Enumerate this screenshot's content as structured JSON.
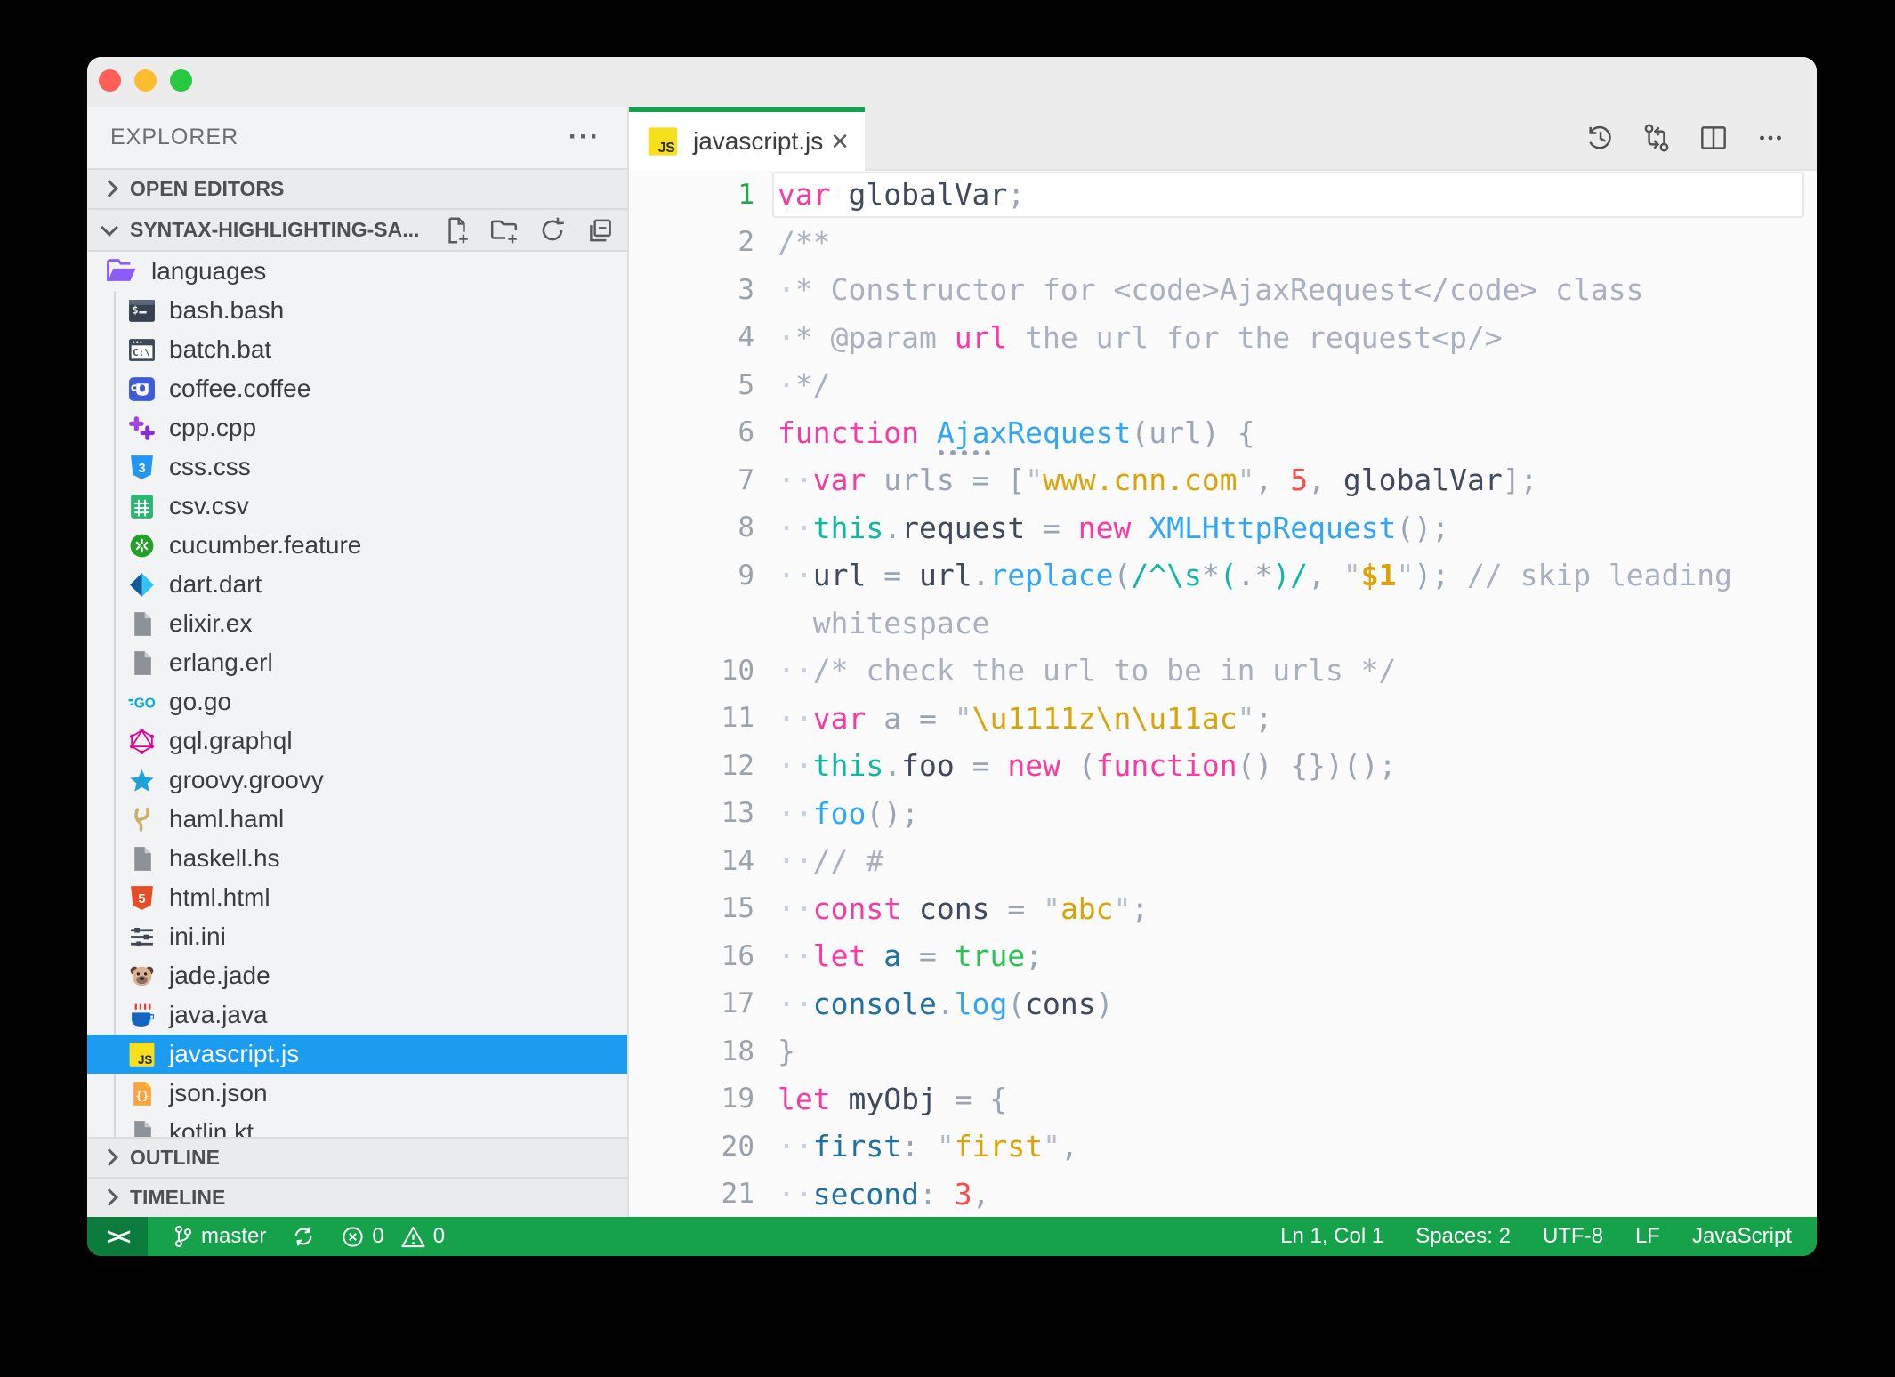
{
  "window": {
    "traffic_lights": [
      "#ff5f57",
      "#febc2e",
      "#28c840"
    ]
  },
  "explorer": {
    "title": "EXPLORER",
    "more_label": "···",
    "sections": {
      "open_editors": "OPEN EDITORS",
      "workspace": "SYNTAX-HIGHLIGHTING-SA...",
      "outline": "OUTLINE",
      "timeline": "TIMELINE"
    },
    "workspace_actions": [
      {
        "name": "new-file"
      },
      {
        "name": "new-folder"
      },
      {
        "name": "refresh-explorer"
      },
      {
        "name": "collapse-folders"
      }
    ],
    "tree": [
      {
        "label": "languages",
        "icon": "folder",
        "type": "folder"
      },
      {
        "label": "bash.bash",
        "icon": "bash"
      },
      {
        "label": "batch.bat",
        "icon": "bat"
      },
      {
        "label": "coffee.coffee",
        "icon": "coffee"
      },
      {
        "label": "cpp.cpp",
        "icon": "cpp"
      },
      {
        "label": "css.css",
        "icon": "css"
      },
      {
        "label": "csv.csv",
        "icon": "csv"
      },
      {
        "label": "cucumber.feature",
        "icon": "cucumber"
      },
      {
        "label": "dart.dart",
        "icon": "dart"
      },
      {
        "label": "elixir.ex",
        "icon": "file"
      },
      {
        "label": "erlang.erl",
        "icon": "file"
      },
      {
        "label": "go.go",
        "icon": "go"
      },
      {
        "label": "gql.graphql",
        "icon": "graphql"
      },
      {
        "label": "groovy.groovy",
        "icon": "groovy"
      },
      {
        "label": "haml.haml",
        "icon": "haml"
      },
      {
        "label": "haskell.hs",
        "icon": "file"
      },
      {
        "label": "html.html",
        "icon": "html"
      },
      {
        "label": "ini.ini",
        "icon": "ini"
      },
      {
        "label": "jade.jade",
        "icon": "jade"
      },
      {
        "label": "java.java",
        "icon": "java"
      },
      {
        "label": "javascript.js",
        "icon": "js",
        "selected": true
      },
      {
        "label": "json.json",
        "icon": "json"
      },
      {
        "label": "kotlin.kt",
        "icon": "file"
      }
    ]
  },
  "tab": {
    "label": "javascript.js",
    "icon": "js",
    "close_glyph": "×"
  },
  "editor_actions": [
    {
      "name": "timeline-history"
    },
    {
      "name": "open-changes"
    },
    {
      "name": "split-editor"
    },
    {
      "name": "more-actions"
    }
  ],
  "code": {
    "lines": [
      {
        "n": "1",
        "current": true,
        "t": [
          [
            "var",
            "kw"
          ],
          [
            " ",
            "op"
          ],
          [
            "globalVar",
            "id"
          ],
          [
            ";",
            "op"
          ]
        ]
      },
      {
        "n": "2",
        "t": [
          [
            "/**",
            "cmt"
          ]
        ]
      },
      {
        "n": "3",
        "t": [
          [
            "·",
            "ws"
          ],
          [
            "* Constructor for <code>AjaxRequest</code> class",
            "cmt"
          ]
        ]
      },
      {
        "n": "4",
        "t": [
          [
            "·",
            "ws"
          ],
          [
            "* @param ",
            "cmt"
          ],
          [
            "url",
            "kw"
          ],
          [
            " the url for the request<p/>",
            "cmt"
          ]
        ]
      },
      {
        "n": "5",
        "t": [
          [
            "·",
            "ws"
          ],
          [
            "*/",
            "cmt"
          ]
        ]
      },
      {
        "n": "6",
        "t": [
          [
            "function",
            "kw"
          ],
          [
            " ",
            "op"
          ],
          [
            "AjaxRequest",
            "fn hint"
          ],
          [
            "(",
            "op"
          ],
          [
            "url",
            "fade"
          ],
          [
            ") {",
            "op"
          ]
        ]
      },
      {
        "n": "7",
        "t": [
          [
            "··",
            "ws"
          ],
          [
            "var",
            "kw"
          ],
          [
            " ",
            "op"
          ],
          [
            "urls",
            "fade"
          ],
          [
            " = [",
            "op"
          ],
          [
            "\"",
            "sq"
          ],
          [
            "www.cnn.com",
            "str"
          ],
          [
            "\"",
            "sq"
          ],
          [
            ", ",
            "op"
          ],
          [
            "5",
            "num"
          ],
          [
            ", ",
            "op"
          ],
          [
            "globalVar",
            "id"
          ],
          [
            "];",
            "op"
          ]
        ]
      },
      {
        "n": "8",
        "t": [
          [
            "··",
            "ws"
          ],
          [
            "this",
            "ths"
          ],
          [
            ".",
            "op"
          ],
          [
            "request",
            "id"
          ],
          [
            " = ",
            "op"
          ],
          [
            "new",
            "kw"
          ],
          [
            " ",
            "op"
          ],
          [
            "XMLHttpRequest",
            "fn"
          ],
          [
            "();",
            "op"
          ]
        ]
      },
      {
        "n": "9",
        "t": [
          [
            "··",
            "ws"
          ],
          [
            "url",
            "id"
          ],
          [
            " = ",
            "op"
          ],
          [
            "url",
            "id"
          ],
          [
            ".",
            "op"
          ],
          [
            "replace",
            "fn"
          ],
          [
            "(",
            "op"
          ],
          [
            "/^\\s",
            "rx"
          ],
          [
            "*",
            "op"
          ],
          [
            "(",
            "rx"
          ],
          [
            ".*",
            "op"
          ],
          [
            ")",
            "rx"
          ],
          [
            "/",
            "rx"
          ],
          [
            ", ",
            "op"
          ],
          [
            "\"",
            "sq"
          ],
          [
            "$1",
            "strb"
          ],
          [
            "\"",
            "sq"
          ],
          [
            "); ",
            "op"
          ],
          [
            "// skip leading",
            "cmt"
          ]
        ]
      },
      {
        "n": "",
        "t": [
          [
            "  ",
            "op"
          ],
          [
            "whitespace",
            "cmt"
          ]
        ]
      },
      {
        "n": "10",
        "t": [
          [
            "··",
            "ws"
          ],
          [
            "/* check the url to be in urls */",
            "cmt"
          ]
        ]
      },
      {
        "n": "11",
        "t": [
          [
            "··",
            "ws"
          ],
          [
            "var",
            "kw"
          ],
          [
            " ",
            "op"
          ],
          [
            "a",
            "fade"
          ],
          [
            " = ",
            "op"
          ],
          [
            "\"",
            "sq"
          ],
          [
            "\\u1111z\\n\\u11ac",
            "str"
          ],
          [
            "\"",
            "sq"
          ],
          [
            ";",
            "op"
          ]
        ]
      },
      {
        "n": "12",
        "t": [
          [
            "··",
            "ws"
          ],
          [
            "this",
            "ths"
          ],
          [
            ".",
            "op"
          ],
          [
            "foo",
            "id"
          ],
          [
            " = ",
            "op"
          ],
          [
            "new",
            "kw"
          ],
          [
            " (",
            "op"
          ],
          [
            "function",
            "kw"
          ],
          [
            "() {})();",
            "op"
          ]
        ]
      },
      {
        "n": "13",
        "t": [
          [
            "··",
            "ws"
          ],
          [
            "foo",
            "fn"
          ],
          [
            "();",
            "op"
          ]
        ]
      },
      {
        "n": "14",
        "t": [
          [
            "··",
            "ws"
          ],
          [
            "// #",
            "cmt"
          ]
        ]
      },
      {
        "n": "15",
        "t": [
          [
            "··",
            "ws"
          ],
          [
            "const",
            "kw"
          ],
          [
            " ",
            "op"
          ],
          [
            "cons",
            "id"
          ],
          [
            " = ",
            "op"
          ],
          [
            "\"",
            "sq"
          ],
          [
            "abc",
            "str"
          ],
          [
            "\"",
            "sq"
          ],
          [
            ";",
            "op"
          ]
        ]
      },
      {
        "n": "16",
        "t": [
          [
            "··",
            "ws"
          ],
          [
            "let",
            "kw"
          ],
          [
            " ",
            "op"
          ],
          [
            "a",
            "prop"
          ],
          [
            " = ",
            "op"
          ],
          [
            "true",
            "bool"
          ],
          [
            ";",
            "op"
          ]
        ]
      },
      {
        "n": "17",
        "t": [
          [
            "··",
            "ws"
          ],
          [
            "console",
            "prop"
          ],
          [
            ".",
            "op"
          ],
          [
            "log",
            "fn"
          ],
          [
            "(",
            "op"
          ],
          [
            "cons",
            "id"
          ],
          [
            ")",
            "op"
          ]
        ]
      },
      {
        "n": "18",
        "t": [
          [
            "}",
            "op"
          ]
        ]
      },
      {
        "n": "19",
        "t": [
          [
            "let",
            "kw"
          ],
          [
            " ",
            "op"
          ],
          [
            "myObj",
            "id"
          ],
          [
            " = {",
            "op"
          ]
        ]
      },
      {
        "n": "20",
        "t": [
          [
            "··",
            "ws"
          ],
          [
            "first",
            "prop"
          ],
          [
            ": ",
            "op"
          ],
          [
            "\"",
            "sq"
          ],
          [
            "first",
            "str"
          ],
          [
            "\"",
            "sq"
          ],
          [
            ",",
            "op"
          ]
        ]
      },
      {
        "n": "21",
        "t": [
          [
            "··",
            "ws"
          ],
          [
            "second",
            "prop"
          ],
          [
            ": ",
            "op"
          ],
          [
            "3",
            "num"
          ],
          [
            ",",
            "op"
          ]
        ]
      }
    ]
  },
  "statusbar": {
    "remote_glyph": "><",
    "branch": "master",
    "errors": "0",
    "warnings": "0",
    "right_items": [
      "Ln 1, Col 1",
      "Spaces: 2",
      "UTF-8",
      "LF",
      "JavaScript"
    ]
  },
  "colors": {
    "accent_green": "#15a24b",
    "remote_green": "#0c7c3c",
    "selection_blue": "#1b9cf1",
    "tab_accent": "#14a24b",
    "keyword_pink": "#f93aa2",
    "function_blue": "#31a7f3",
    "string_gold": "#d9a40a",
    "number_red": "#fb4b4b",
    "this_teal": "#0cb9a4",
    "boolean_green": "#2cc252"
  }
}
